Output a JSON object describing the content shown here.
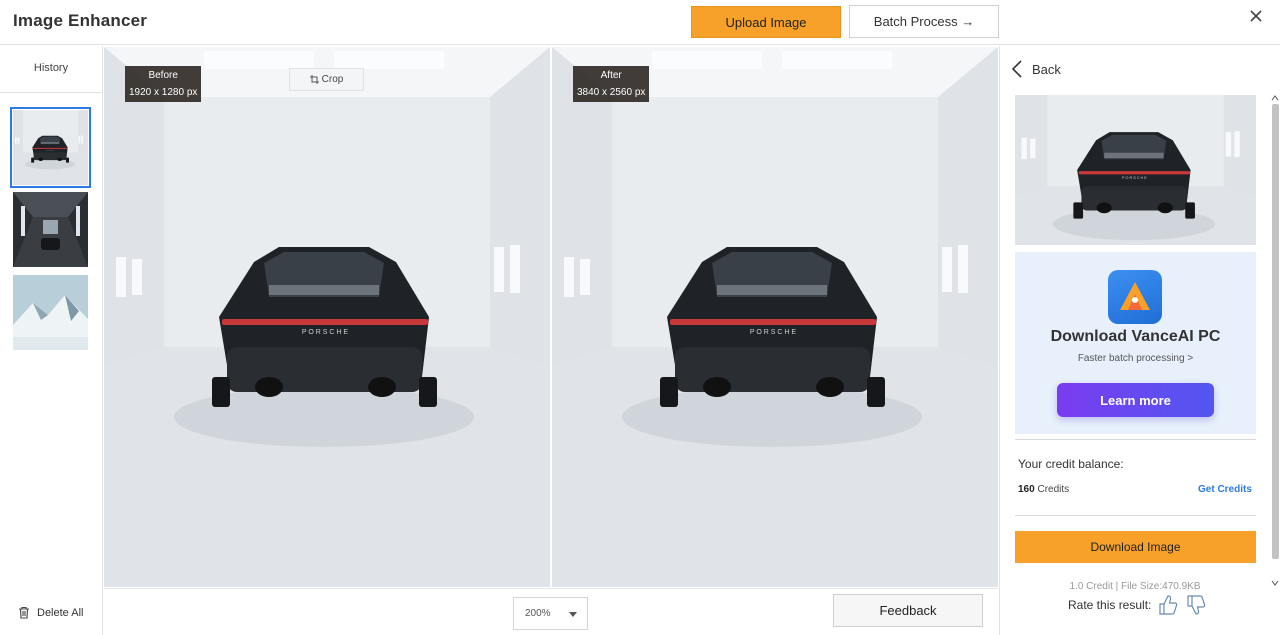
{
  "header": {
    "title": "Image Enhancer",
    "upload_label": "Upload Image",
    "batch_label": "Batch Process →"
  },
  "sidebar": {
    "history_label": "History",
    "delete_all_label": "Delete All",
    "thumbnails": [
      {
        "name": "white-garage-car",
        "selected": true
      },
      {
        "name": "dark-tunnel-garage",
        "selected": false
      },
      {
        "name": "snowy-mountain",
        "selected": false
      }
    ]
  },
  "compare": {
    "before_label": "Before",
    "before_size": "1920 x 1280 px",
    "after_label": "After",
    "after_size": "3840 x 2560 px",
    "crop_label": "Crop",
    "brand_text": "PORSCHE"
  },
  "bottom": {
    "zoom_value": "200%",
    "feedback_label": "Feedback"
  },
  "panel": {
    "back_label": "Back",
    "promo_title": "Download VanceAI PC",
    "promo_sub": "Faster batch processing >",
    "learn_more_label": "Learn more",
    "credit_label": "Your credit balance:",
    "credit_amount": "160",
    "credit_unit": "Credits",
    "get_credits_label": "Get Credits",
    "download_label": "Download Image",
    "file_info": "1.0 Credit | File Size:470.9KB",
    "rate_label": "Rate this result:"
  },
  "colors": {
    "accent_orange": "#f7a12b",
    "link_blue": "#2d7be5",
    "promo_purple": "#7a3cf0"
  }
}
